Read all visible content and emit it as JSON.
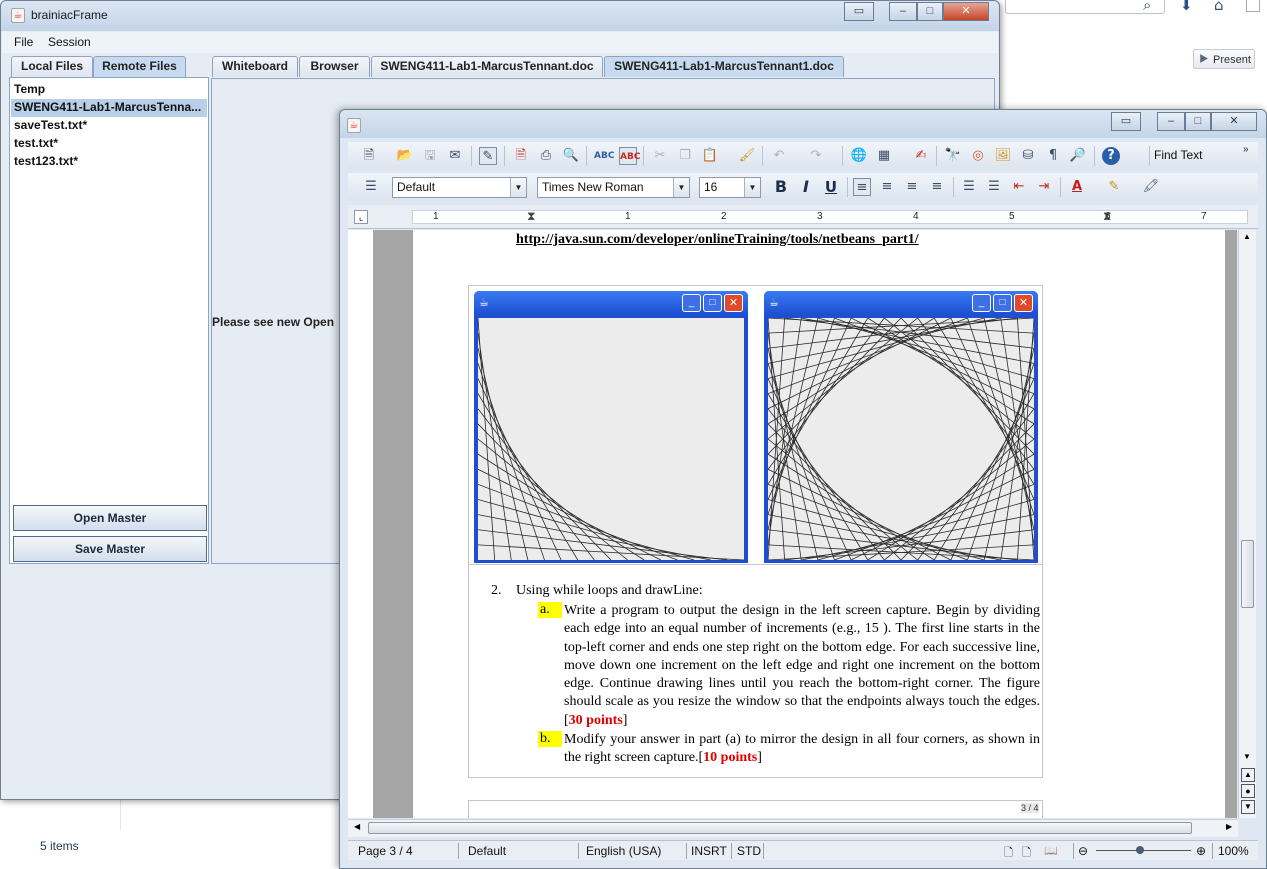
{
  "explorer": {
    "present_label": "Present",
    "items_count": "5 items"
  },
  "brainiac": {
    "title": "brainiacFrame",
    "menu": [
      "File",
      "Session"
    ],
    "left_tabs": [
      "Local Files",
      "Remote Files"
    ],
    "files": [
      "Temp",
      "SWENG411-Lab1-MarcusTenna...",
      "saveTest.txt*",
      "test.txt*",
      "test123.txt*"
    ],
    "open_master": "Open Master",
    "save_master": "Save Master",
    "right_tabs": [
      "Whiteboard",
      "Browser",
      "SWENG411-Lab1-MarcusTennant.doc",
      "SWENG411-Lab1-MarcusTennant1.doc"
    ],
    "notice": "Please see new Open"
  },
  "writer": {
    "find_text": "Find Text",
    "paragraph_style": "Default",
    "font_name": "Times New Roman",
    "font_size": "16",
    "ruler_numbers": [
      "1",
      "1",
      "2",
      "3",
      "4",
      "5",
      "6",
      "7"
    ],
    "doc": {
      "url": "http://java.sun.com/developer/onlineTraining/tools/netbeans_part1/",
      "item_number": "2.",
      "item_text": "Using while loops and drawLine:",
      "sub_a_marker": "a.",
      "sub_a_text": "Write a program to output the design in the left screen capture. Begin by dividing each edge into an equal number of increments (e.g., 15 ). The first line starts in the top-left corner and ends one step right on the bottom edge. For each successive line, move down one increment on the left edge and right one increment on the bottom edge. Continue drawing lines until you reach the bottom-right corner. The figure should scale as you resize the window so that the endpoints always touch the edges. [",
      "sub_a_points": "30 points",
      "sub_b_marker": "b.",
      "sub_b_text": "Modify your answer in part (a) to mirror the design in all four corners, as shown in the right screen capture.[",
      "sub_b_points": "10 points",
      "page_marker": "3 / 4"
    },
    "status": {
      "page": "Page 3 / 4",
      "style": "Default",
      "language": "English (USA)",
      "mode": "INSRT",
      "sel": "STD",
      "zoom": "100%"
    }
  }
}
